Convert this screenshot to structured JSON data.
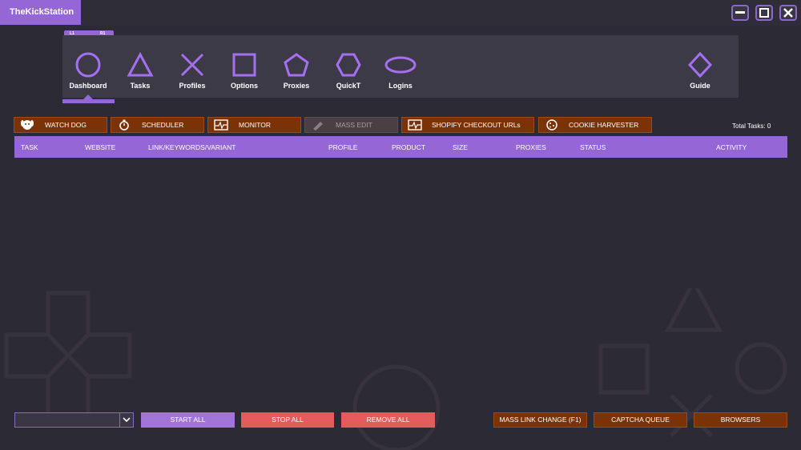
{
  "app": {
    "title": "TheKickStation"
  },
  "window_controls": {
    "minimize_icon": "minimize-icon",
    "maximize_icon": "maximize-icon",
    "close_icon": "close-icon"
  },
  "nav": {
    "shoulder_left": "L1",
    "shoulder_right": "R1",
    "active": "Dashboard",
    "items": [
      {
        "label": "Dashboard",
        "icon": "circle-icon"
      },
      {
        "label": "Tasks",
        "icon": "triangle-icon"
      },
      {
        "label": "Profiles",
        "icon": "cross-icon"
      },
      {
        "label": "Options",
        "icon": "square-icon"
      },
      {
        "label": "Proxies",
        "icon": "pentagon-icon"
      },
      {
        "label": "QuickT",
        "icon": "hexagon-icon"
      },
      {
        "label": "Logins",
        "icon": "ellipse-icon"
      },
      {
        "label": "Guide",
        "icon": "diamond-icon"
      }
    ]
  },
  "toolbar": {
    "watch_dog": "WATCH DOG",
    "scheduler": "SCHEDULER",
    "monitor": "MONITOR",
    "mass_edit": "MASS EDIT",
    "shopify_checkout_urls": "SHOPIFY CHECKOUT URLs",
    "cookie_harvester": "COOKIE HARVESTER"
  },
  "total_tasks": "Total Tasks: 0",
  "table": {
    "columns": [
      "TASK",
      "WEBSITE",
      "LINK/KEYWORDS/VARIANT",
      "PROFILE",
      "PRODUCT",
      "SIZE",
      "PROXIES",
      "STATUS",
      "ACTIVITY"
    ],
    "rows": []
  },
  "bottom": {
    "group_select_value": "",
    "start_all": "START ALL",
    "stop_all": "STOP ALL",
    "remove_all": "REMOVE ALL",
    "mass_link_change": "MASS LINK CHANGE (F1)",
    "captcha_queue": "CAPTCHA QUEUE",
    "browsers": "BROWSERS"
  },
  "colors": {
    "accent_purple": "#9466d6",
    "orange_button": "#7a3206",
    "red_button": "#e35b5b",
    "background": "#2c2a35",
    "panel": "#3d3a48"
  }
}
